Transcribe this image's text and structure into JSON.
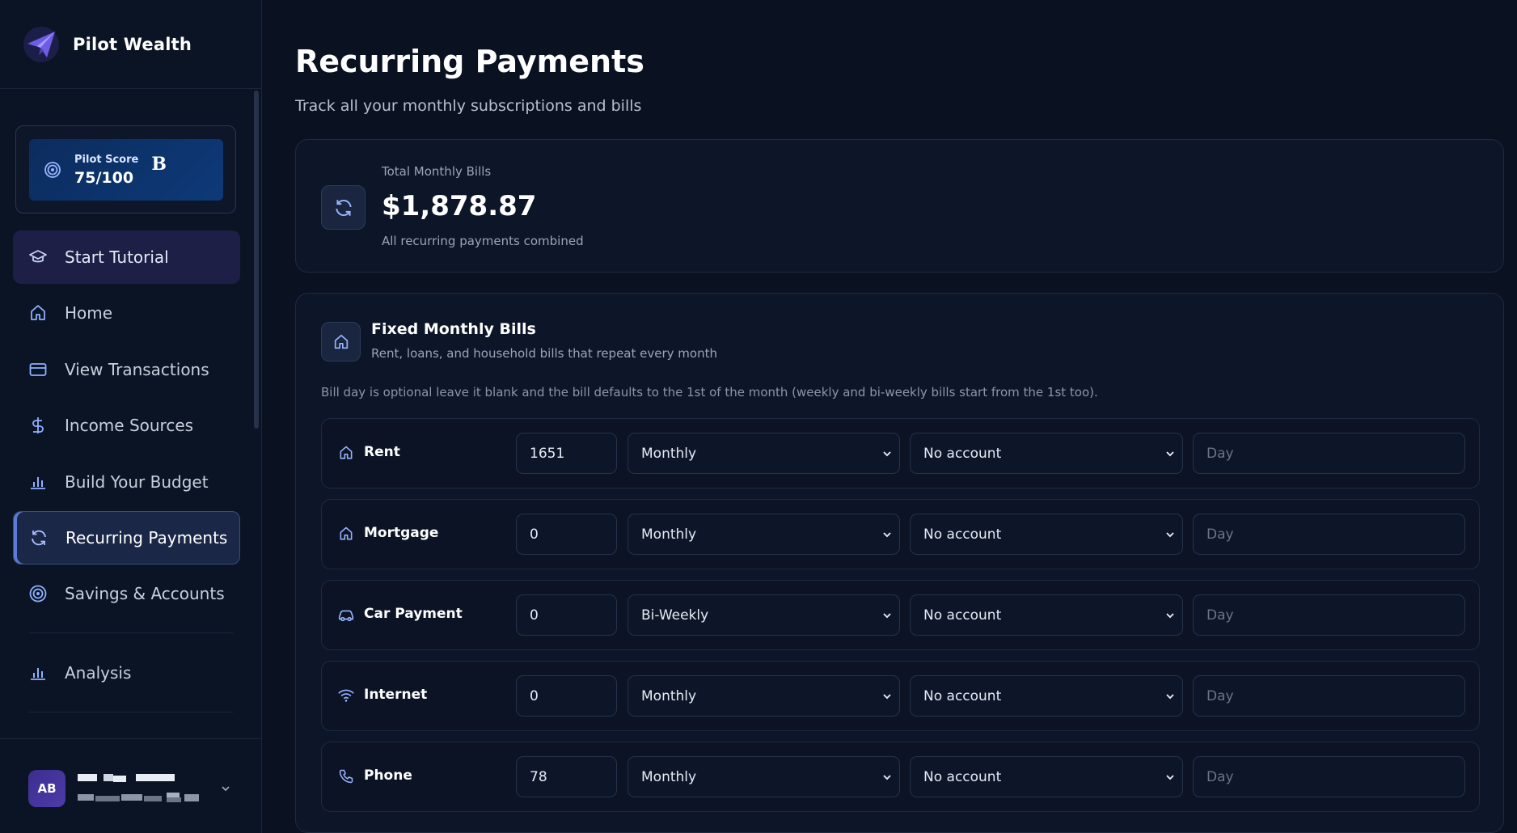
{
  "brand": {
    "name": "Pilot Wealth"
  },
  "score": {
    "label": "Pilot Score",
    "value": "75/100",
    "grade": "B"
  },
  "nav": {
    "tutorial": "Start Tutorial",
    "home": "Home",
    "transactions": "View Transactions",
    "income": "Income Sources",
    "budget": "Build Your Budget",
    "recurring": "Recurring Payments",
    "savings": "Savings & Accounts",
    "analysis": "Analysis"
  },
  "user": {
    "initials": "AB"
  },
  "page": {
    "title": "Recurring Payments",
    "subtitle": "Track all your monthly subscriptions and bills"
  },
  "total": {
    "label": "Total Monthly Bills",
    "value": "$1,878.87",
    "note": "All recurring payments combined"
  },
  "bills": {
    "title": "Fixed Monthly Bills",
    "subtitle": "Rent, loans, and household bills that repeat every month",
    "note": "Bill day is optional leave it blank and the bill defaults to the 1st of the month (weekly and bi-weekly bills start from the 1st too).",
    "day_placeholder": "Day",
    "rows": [
      {
        "name": "Rent",
        "icon": "house-icon",
        "amount": "1651",
        "frequency": "Monthly",
        "account": "No account"
      },
      {
        "name": "Mortgage",
        "icon": "house-icon",
        "amount": "0",
        "frequency": "Monthly",
        "account": "No account"
      },
      {
        "name": "Car Payment",
        "icon": "car-icon",
        "amount": "0",
        "frequency": "Bi-Weekly",
        "account": "No account"
      },
      {
        "name": "Internet",
        "icon": "wifi-icon",
        "amount": "0",
        "frequency": "Monthly",
        "account": "No account"
      },
      {
        "name": "Phone",
        "icon": "phone-icon",
        "amount": "78",
        "frequency": "Monthly",
        "account": "No account"
      }
    ]
  },
  "colors": {
    "accent": "#5b7bd6",
    "background": "#0a1120",
    "card": "#0d1628"
  }
}
